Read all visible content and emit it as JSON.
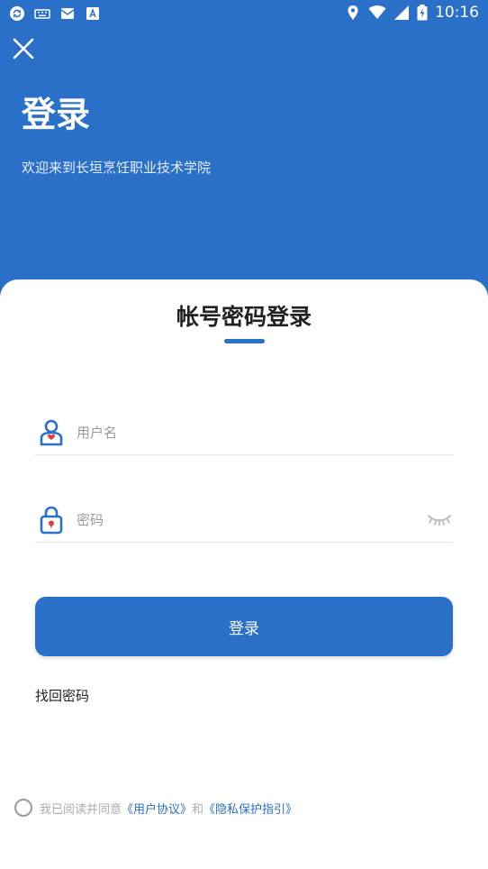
{
  "status_bar": {
    "time": "10:16",
    "icons_left": [
      "sync-icon",
      "keyboard-icon",
      "mail-icon",
      "font-app-icon"
    ],
    "icons_right": [
      "location-icon",
      "wifi-icon",
      "signal-icon",
      "battery-icon"
    ]
  },
  "header": {
    "title": "登录",
    "subtitle": "欢迎来到长垣烹饪职业技术学院",
    "background_color": "#2a6fc8"
  },
  "card": {
    "title": "帐号密码登录",
    "username": {
      "placeholder": "用户名",
      "value": "",
      "icon": "user-icon"
    },
    "password": {
      "placeholder": "密码",
      "value": "",
      "icon": "lock-icon",
      "toggle_icon": "eye-closed-icon"
    },
    "login_button": "登录",
    "forgot_password": "找回密码"
  },
  "agreement": {
    "prefix": "我已阅读并同意",
    "user_agreement": "《用户协议》",
    "and": "和",
    "privacy_policy": "《隐私保护指引》",
    "checked": false
  },
  "accent_color": "#2a6fc8"
}
